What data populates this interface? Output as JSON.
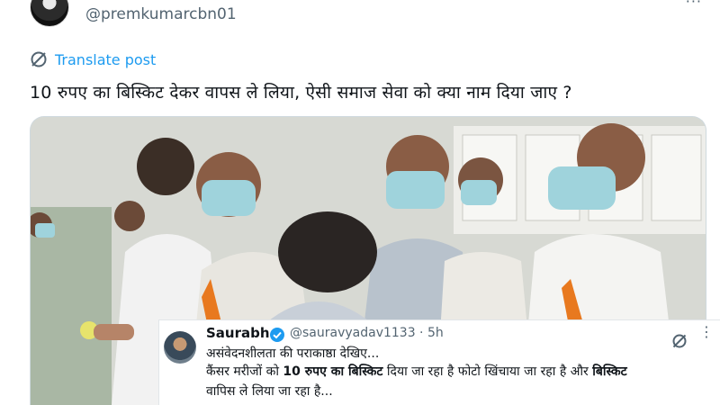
{
  "post": {
    "handle": "@premkumarcbn01",
    "translate_label": "Translate post",
    "text": "10 रुपए का बिस्किट देकर वापस ले लिया, ऐसी समाज सेवा को क्या नाम दिया जाए ?"
  },
  "quote": {
    "name": "Saurabh",
    "handle_time": "@sauravyadav1133 · 5h",
    "line1": "असंवेदनशीलता की पराकाष्ठा देखिए...",
    "line2_a": "कैंसर मरीजों को ",
    "line2_b": "10 रुपए का बिस्किट",
    "line2_c": " दिया जा रहा है फोटो खिंचाया जा रहा है और ",
    "line2_d": "बिस्किट",
    "line3": "वापिस ले लिया जा रहा है..."
  },
  "colors": {
    "link": "#1d9bf0",
    "muted": "#536471",
    "text": "#0f1419",
    "verified": "#1d9bf0"
  }
}
